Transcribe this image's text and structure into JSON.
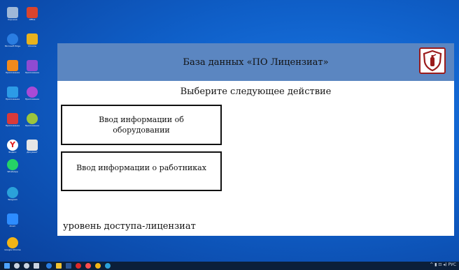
{
  "desktop": {
    "icons": [
      {
        "name": "recycle-bin-icon",
        "label": "Корзина",
        "color": "#9fb8d8"
      },
      {
        "name": "office-icon",
        "label": "Office",
        "color": "#d8442e"
      },
      {
        "name": "edge-icon",
        "label": "Microsoft Edge",
        "color": "#2a7de1"
      },
      {
        "name": "chrome-doc-icon",
        "label": "Chrome",
        "color": "#e8b21d"
      },
      {
        "name": "app-orange-icon",
        "label": "Приложение",
        "color": "#f18a1c"
      },
      {
        "name": "app-purple-icon",
        "label": "Приложение",
        "color": "#8f4bd2"
      },
      {
        "name": "app-blue-icon",
        "label": "Приложение",
        "color": "#2c9be6"
      },
      {
        "name": "app-violet-icon",
        "label": "Приложение",
        "color": "#a94ad6"
      },
      {
        "name": "app-red-icon",
        "label": "Приложение",
        "color": "#d83a3a"
      },
      {
        "name": "app-lime-icon",
        "label": "Приложение",
        "color": "#9bc53d"
      },
      {
        "name": "yandex-icon",
        "label": "Яндекс",
        "color": "#ffffff"
      },
      {
        "name": "doc-icon",
        "label": "Документ",
        "color": "#e6e6e6"
      },
      {
        "name": "whatsapp-icon",
        "label": "WhatsApp",
        "color": "#25d366"
      },
      {
        "name": "telegram-icon",
        "label": "Telegram",
        "color": "#2aa1da"
      },
      {
        "name": "zoom-icon",
        "label": "Zoom",
        "color": "#2d8cff"
      },
      {
        "name": "chrome-icon",
        "label": "Google Chrome",
        "color": "#f2b416"
      }
    ]
  },
  "app": {
    "title": "База данных «ПО Лицензиат»",
    "prompt": "Выберите следующее действие",
    "buttons": {
      "equipment": "Ввод информации об оборудовании",
      "employees": "Ввод информации о работниках"
    },
    "access_level": "уровень доступа-лицензиат",
    "colors": {
      "header": "#5b86c1",
      "logo_border": "#9a1b1b"
    }
  },
  "taskbar": {
    "icons": [
      "start-icon",
      "search-icon",
      "cortana-icon",
      "taskview-icon",
      "edge-taskbar-icon",
      "explorer-icon",
      "word-icon",
      "opera-icon",
      "yandex-taskbar-icon",
      "chrome-taskbar-icon",
      "telegram-taskbar-icon"
    ],
    "tray": "^ ▮ ⊡ ◂) РУС"
  }
}
